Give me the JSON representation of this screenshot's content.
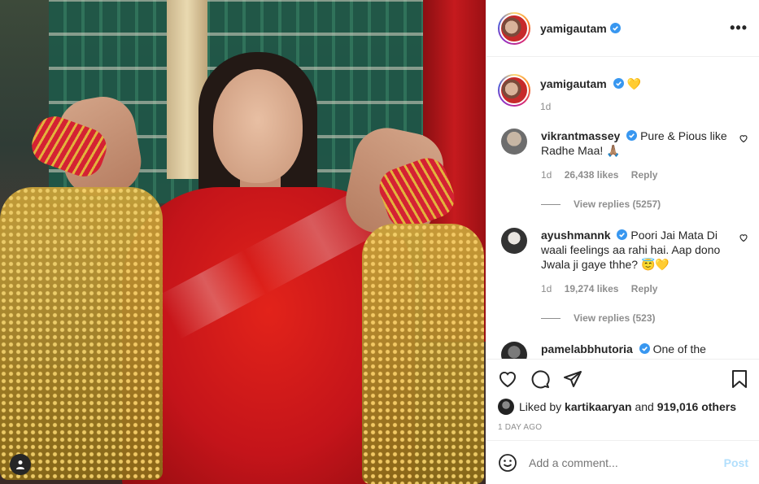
{
  "post": {
    "username": "yamigautam",
    "more_icon": "more-horizontal-icon",
    "verified_color": "#3897f0"
  },
  "caption": {
    "username": "yamigautam",
    "emoji": "💛",
    "time": "1d"
  },
  "comments": [
    {
      "username": "vikrantmassey",
      "text": "Pure & Pious like Radhe Maa! 🙏🏽",
      "time": "1d",
      "likes": "26,438 likes",
      "reply": "Reply",
      "view_replies": "View replies (5257)"
    },
    {
      "username": "ayushmannk",
      "text": "Poori Jai Mata Di waali feelings aa rahi hai. Aap dono Jwala ji gaye thhe? 😇💛",
      "time": "1d",
      "likes": "19,274 likes",
      "reply": "Reply",
      "view_replies": "View replies (523)"
    },
    {
      "username": "pamelabbhutoria",
      "text": "One of the"
    }
  ],
  "actions": {
    "liked_by_prefix": "Liked by",
    "liked_by_user": "kartikaaryan",
    "liked_by_and": "and",
    "others": "919,016 others",
    "timestamp": "1 DAY AGO"
  },
  "add_comment": {
    "placeholder": "Add a comment...",
    "post_label": "Post"
  }
}
